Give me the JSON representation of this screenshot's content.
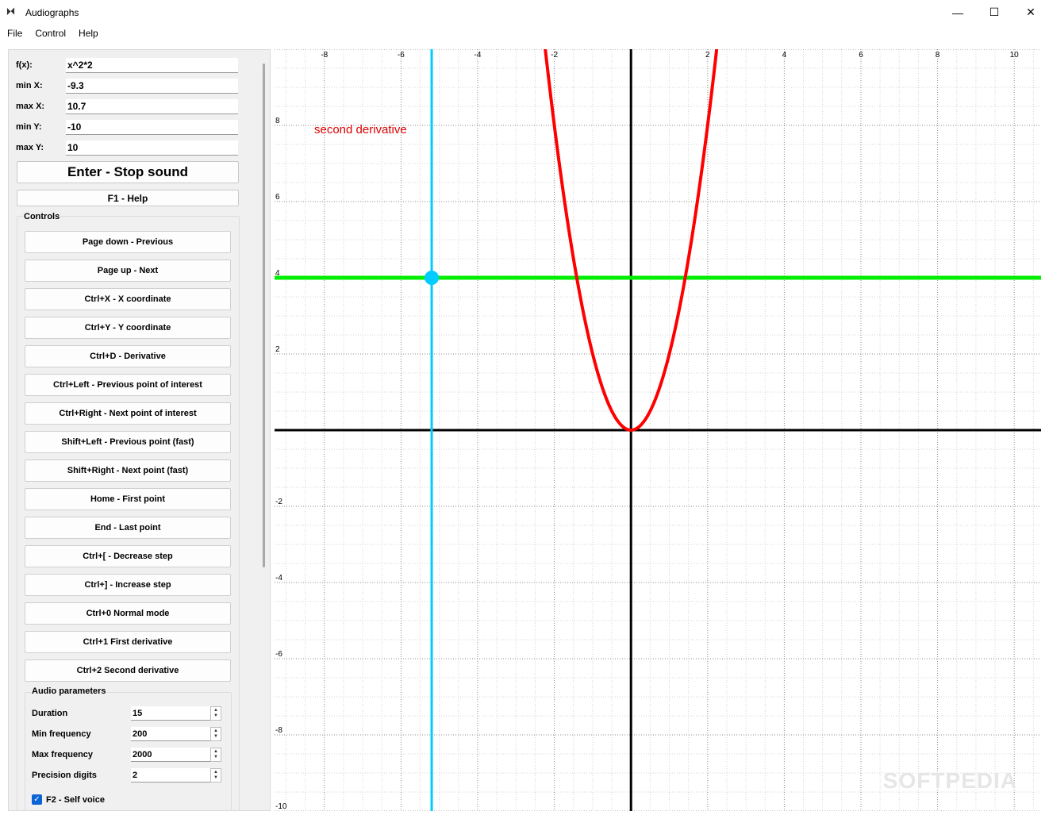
{
  "window": {
    "title": "Audiographs",
    "icon": "audiographs-icon",
    "minimize": "—",
    "maximize": "☐",
    "close": "✕"
  },
  "menu": [
    "File",
    "Control",
    "Help"
  ],
  "fields": [
    {
      "label": "f(x):",
      "value": "x^2*2"
    },
    {
      "label": "min X:",
      "value": "-9.3"
    },
    {
      "label": "max X:",
      "value": "10.7"
    },
    {
      "label": "min Y:",
      "value": "-10"
    },
    {
      "label": "max Y:",
      "value": "10"
    }
  ],
  "enter_button": "Enter - Stop sound",
  "help_button": "F1 - Help",
  "controls_title": "Controls",
  "controls": [
    "Page down - Previous",
    "Page up - Next",
    "Ctrl+X - X coordinate",
    "Ctrl+Y - Y coordinate",
    "Ctrl+D - Derivative",
    "Ctrl+Left - Previous point of interest",
    "Ctrl+Right - Next point of interest",
    "Shift+Left - Previous point (fast)",
    "Shift+Right - Next point (fast)",
    "Home - First point",
    "End - Last point",
    "Ctrl+[ - Decrease step",
    "Ctrl+] - Increase step",
    "Ctrl+0 Normal mode",
    "Ctrl+1 First derivative",
    "Ctrl+2 Second derivative"
  ],
  "audio_title": "Audio parameters",
  "audio": [
    {
      "label": "Duration",
      "value": "15"
    },
    {
      "label": "Min frequency",
      "value": "200"
    },
    {
      "label": "Max frequency",
      "value": "2000"
    },
    {
      "label": "Precision digits",
      "value": "2"
    }
  ],
  "self_voice": {
    "label": "F2 - Self voice",
    "checked": true
  },
  "graph": {
    "mode_label": "second derivative",
    "x_ticks": [
      "-8",
      "-6",
      "-4",
      "-2",
      "2",
      "4",
      "6",
      "8",
      "10"
    ],
    "y_ticks": [
      "8",
      "6",
      "4",
      "2",
      "-2",
      "-4",
      "-6",
      "-8",
      "-10"
    ],
    "x_range": [
      -9.3,
      10.7
    ],
    "y_range": [
      -10,
      10
    ],
    "function": "x^2*2",
    "curve_color": "#ff0000",
    "cursor_x": -5.2,
    "cursor_line_color": "#00ccff",
    "derivative_y": 4,
    "derivative_line_color": "#00ee00",
    "label_color": "#dd0000"
  },
  "watermark": "SOFTPEDIA"
}
